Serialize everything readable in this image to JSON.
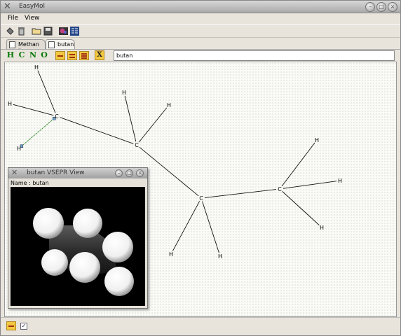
{
  "window": {
    "title": "EasyMol"
  },
  "menu": {
    "file": "File",
    "view": "View"
  },
  "toolbar": {
    "icons": [
      "pointer-icon",
      "trash-icon",
      "open-icon",
      "save-icon",
      "render-icon",
      "grid-icon"
    ]
  },
  "tabs": [
    {
      "label": "Methan",
      "closable": "*"
    },
    {
      "label": "butan"
    }
  ],
  "elements": [
    "H",
    "C",
    "N",
    "O"
  ],
  "bonds": [
    "single-bond-icon",
    "double-bond-icon",
    "triple-bond-icon"
  ],
  "delete_label": "X",
  "molecule_name_input": "butan",
  "atoms": [
    {
      "id": "C1",
      "label": "C"
    },
    {
      "id": "C2",
      "label": "C"
    },
    {
      "id": "C3",
      "label": "C"
    },
    {
      "id": "C4",
      "label": "C"
    },
    {
      "id": "H1",
      "label": "H"
    },
    {
      "id": "H2",
      "label": "H"
    },
    {
      "id": "H3",
      "label": "H"
    },
    {
      "id": "H4",
      "label": "H"
    },
    {
      "id": "H5",
      "label": "H"
    },
    {
      "id": "H6",
      "label": "H"
    },
    {
      "id": "H7",
      "label": "H"
    },
    {
      "id": "H8",
      "label": "H"
    },
    {
      "id": "H9",
      "label": "H"
    },
    {
      "id": "H10",
      "label": "H"
    }
  ],
  "vsepr": {
    "title": "butan VSEPR View",
    "name_line": "Name : butan"
  },
  "colors": {
    "selected_bond": "#2a8a2a",
    "element_text": "#0a7a0a",
    "bond_button": "#f2c840"
  }
}
